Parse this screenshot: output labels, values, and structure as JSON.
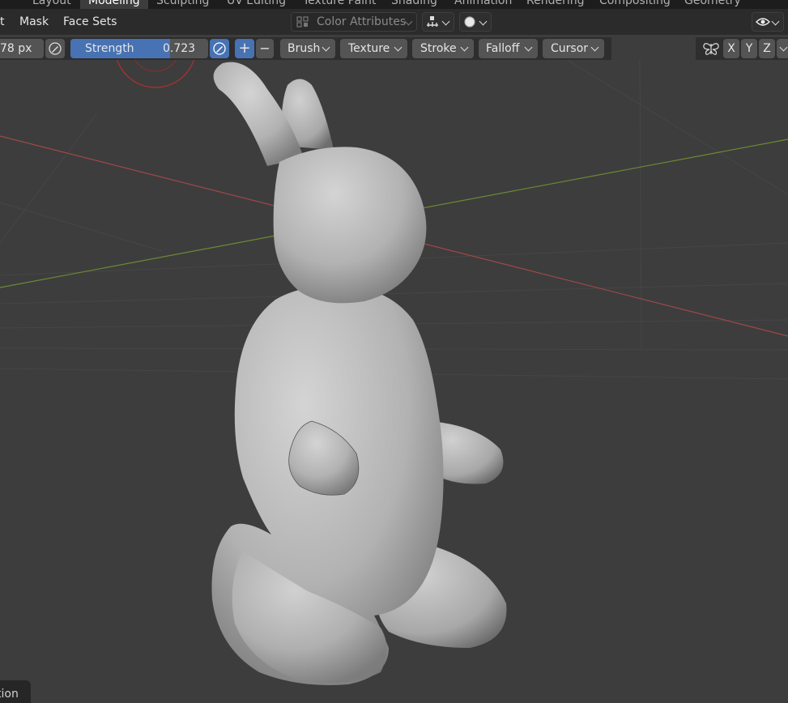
{
  "workspace_tabs": [
    "Layout",
    "Modeling",
    "Sculpting",
    "UV Editing",
    "Texture Paint",
    "Shading",
    "Animation",
    "Rendering",
    "Compositing",
    "Geometry Nodes"
  ],
  "active_workspace": "Modeling",
  "header": {
    "menu_partial": "t",
    "mask_label": "Mask",
    "face_sets_label": "Face Sets",
    "color_attributes_label": "Color Attributes"
  },
  "toolbar": {
    "radius_value": "78 px",
    "strength_label": "Strength",
    "strength_value": "0.723",
    "strength_fraction": 0.723,
    "plus": "+",
    "minus": "−",
    "brush_label": "Brush",
    "texture_label": "Texture",
    "stroke_label": "Stroke",
    "falloff_label": "Falloff",
    "cursor_label": "Cursor",
    "axis_x": "X",
    "axis_y": "Y",
    "axis_z": "Z"
  },
  "status": {
    "partial_label": "tion"
  },
  "colors": {
    "accent": "#4772b3",
    "viewport_bg": "#3d3d3d",
    "x_axis": "#b04a4a",
    "y_axis": "#6f8f30"
  },
  "icons": [
    "pressure-pen-icon",
    "color-attributes-icon",
    "sample-icon",
    "shading-sphere-icon",
    "visibility-eye-icon",
    "symmetry-butterfly-icon",
    "chevron-down-icon"
  ]
}
